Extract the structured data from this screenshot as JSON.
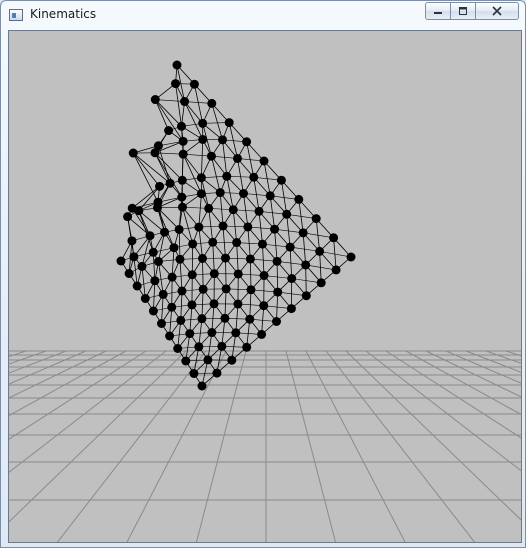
{
  "window": {
    "title": "Kinematics"
  },
  "controls": {
    "minimize_icon": "minimize-icon",
    "maximize_icon": "maximize-icon",
    "close_icon": "close-icon"
  },
  "scene": {
    "background_color": "#c0c0c0",
    "grid_color": "#8a8a8a",
    "mesh_color": "#000000",
    "mesh_node_color": "#000000"
  }
}
